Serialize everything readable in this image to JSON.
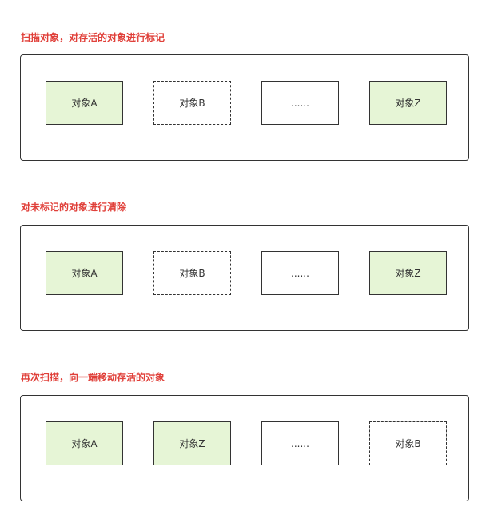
{
  "steps": [
    {
      "title": "扫描对象，对存活的对象进行标记",
      "objects": [
        {
          "label": "对象A",
          "state": "live"
        },
        {
          "label": "对象B",
          "state": "dead"
        },
        {
          "label": "......",
          "state": "plain"
        },
        {
          "label": "对象Z",
          "state": "live"
        }
      ]
    },
    {
      "title": "对未标记的对象进行清除",
      "objects": [
        {
          "label": "对象A",
          "state": "live"
        },
        {
          "label": "对象B",
          "state": "dead"
        },
        {
          "label": "......",
          "state": "plain"
        },
        {
          "label": "对象Z",
          "state": "live"
        }
      ]
    },
    {
      "title": "再次扫描，向一端移动存活的对象",
      "objects": [
        {
          "label": "对象A",
          "state": "live"
        },
        {
          "label": "对象Z",
          "state": "live"
        },
        {
          "label": "......",
          "state": "plain"
        },
        {
          "label": "对象B",
          "state": "dead"
        }
      ]
    }
  ],
  "colors": {
    "title": "#e0403a",
    "live_fill": "#e6f5d6",
    "border": "#333333"
  }
}
